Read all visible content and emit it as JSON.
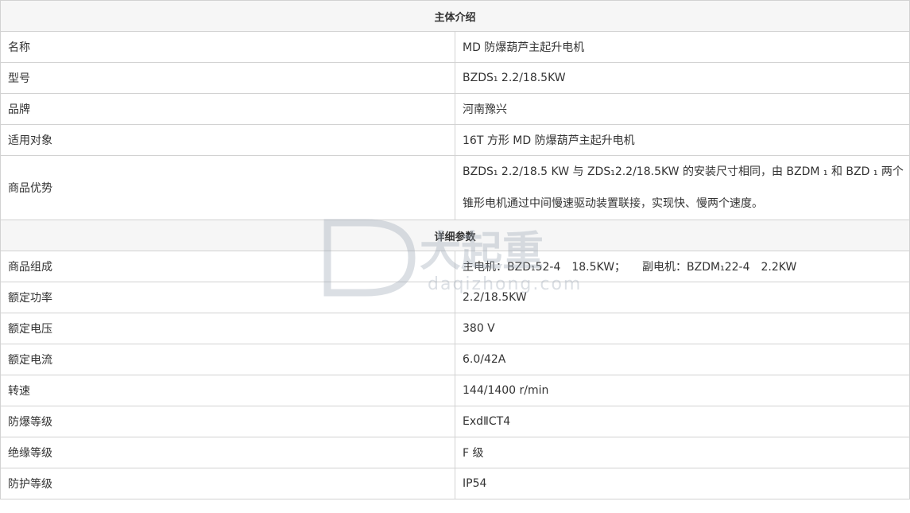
{
  "intro": {
    "header": "主体介绍",
    "rows": [
      {
        "label": "名称",
        "value": "MD 防爆葫芦主起升电机"
      },
      {
        "label": "型号",
        "value": "BZDS₁ 2.2/18.5KW"
      },
      {
        "label": "品牌",
        "value": "河南豫兴"
      },
      {
        "label": "适用对象",
        "value": "16T 方形 MD 防爆葫芦主起升电机"
      },
      {
        "label": "商品优势",
        "value": "BZDS₁ 2.2/18.5 KW 与 ZDS₁2.2/18.5KW 的安装尺寸相同，由 BZDM ₁ 和 BZD ₁ 两个锥形电机通过中间慢速驱动装置联接，实现快、慢两个速度。"
      }
    ]
  },
  "details": {
    "header": "详细参数",
    "rows": [
      {
        "label": "商品组成",
        "value": "主电机：BZD₁52-4　18.5KW；　　副电机：BZDM₁22-4　2.2KW"
      },
      {
        "label": "额定功率",
        "value": "2.2/18.5KW"
      },
      {
        "label": "额定电压",
        "value": "380 V"
      },
      {
        "label": "额定电流",
        "value": "6.0/42A"
      },
      {
        "label": "转速",
        "value": "144/1400 r/min"
      },
      {
        "label": "防爆等级",
        "value": "ExdⅡCT4"
      },
      {
        "label": "绝缘等级",
        "value": "F 级"
      },
      {
        "label": "防护等级",
        "value": "IP54"
      }
    ]
  },
  "watermark": {
    "brand": "大起重",
    "url": "daqizhong.com"
  }
}
